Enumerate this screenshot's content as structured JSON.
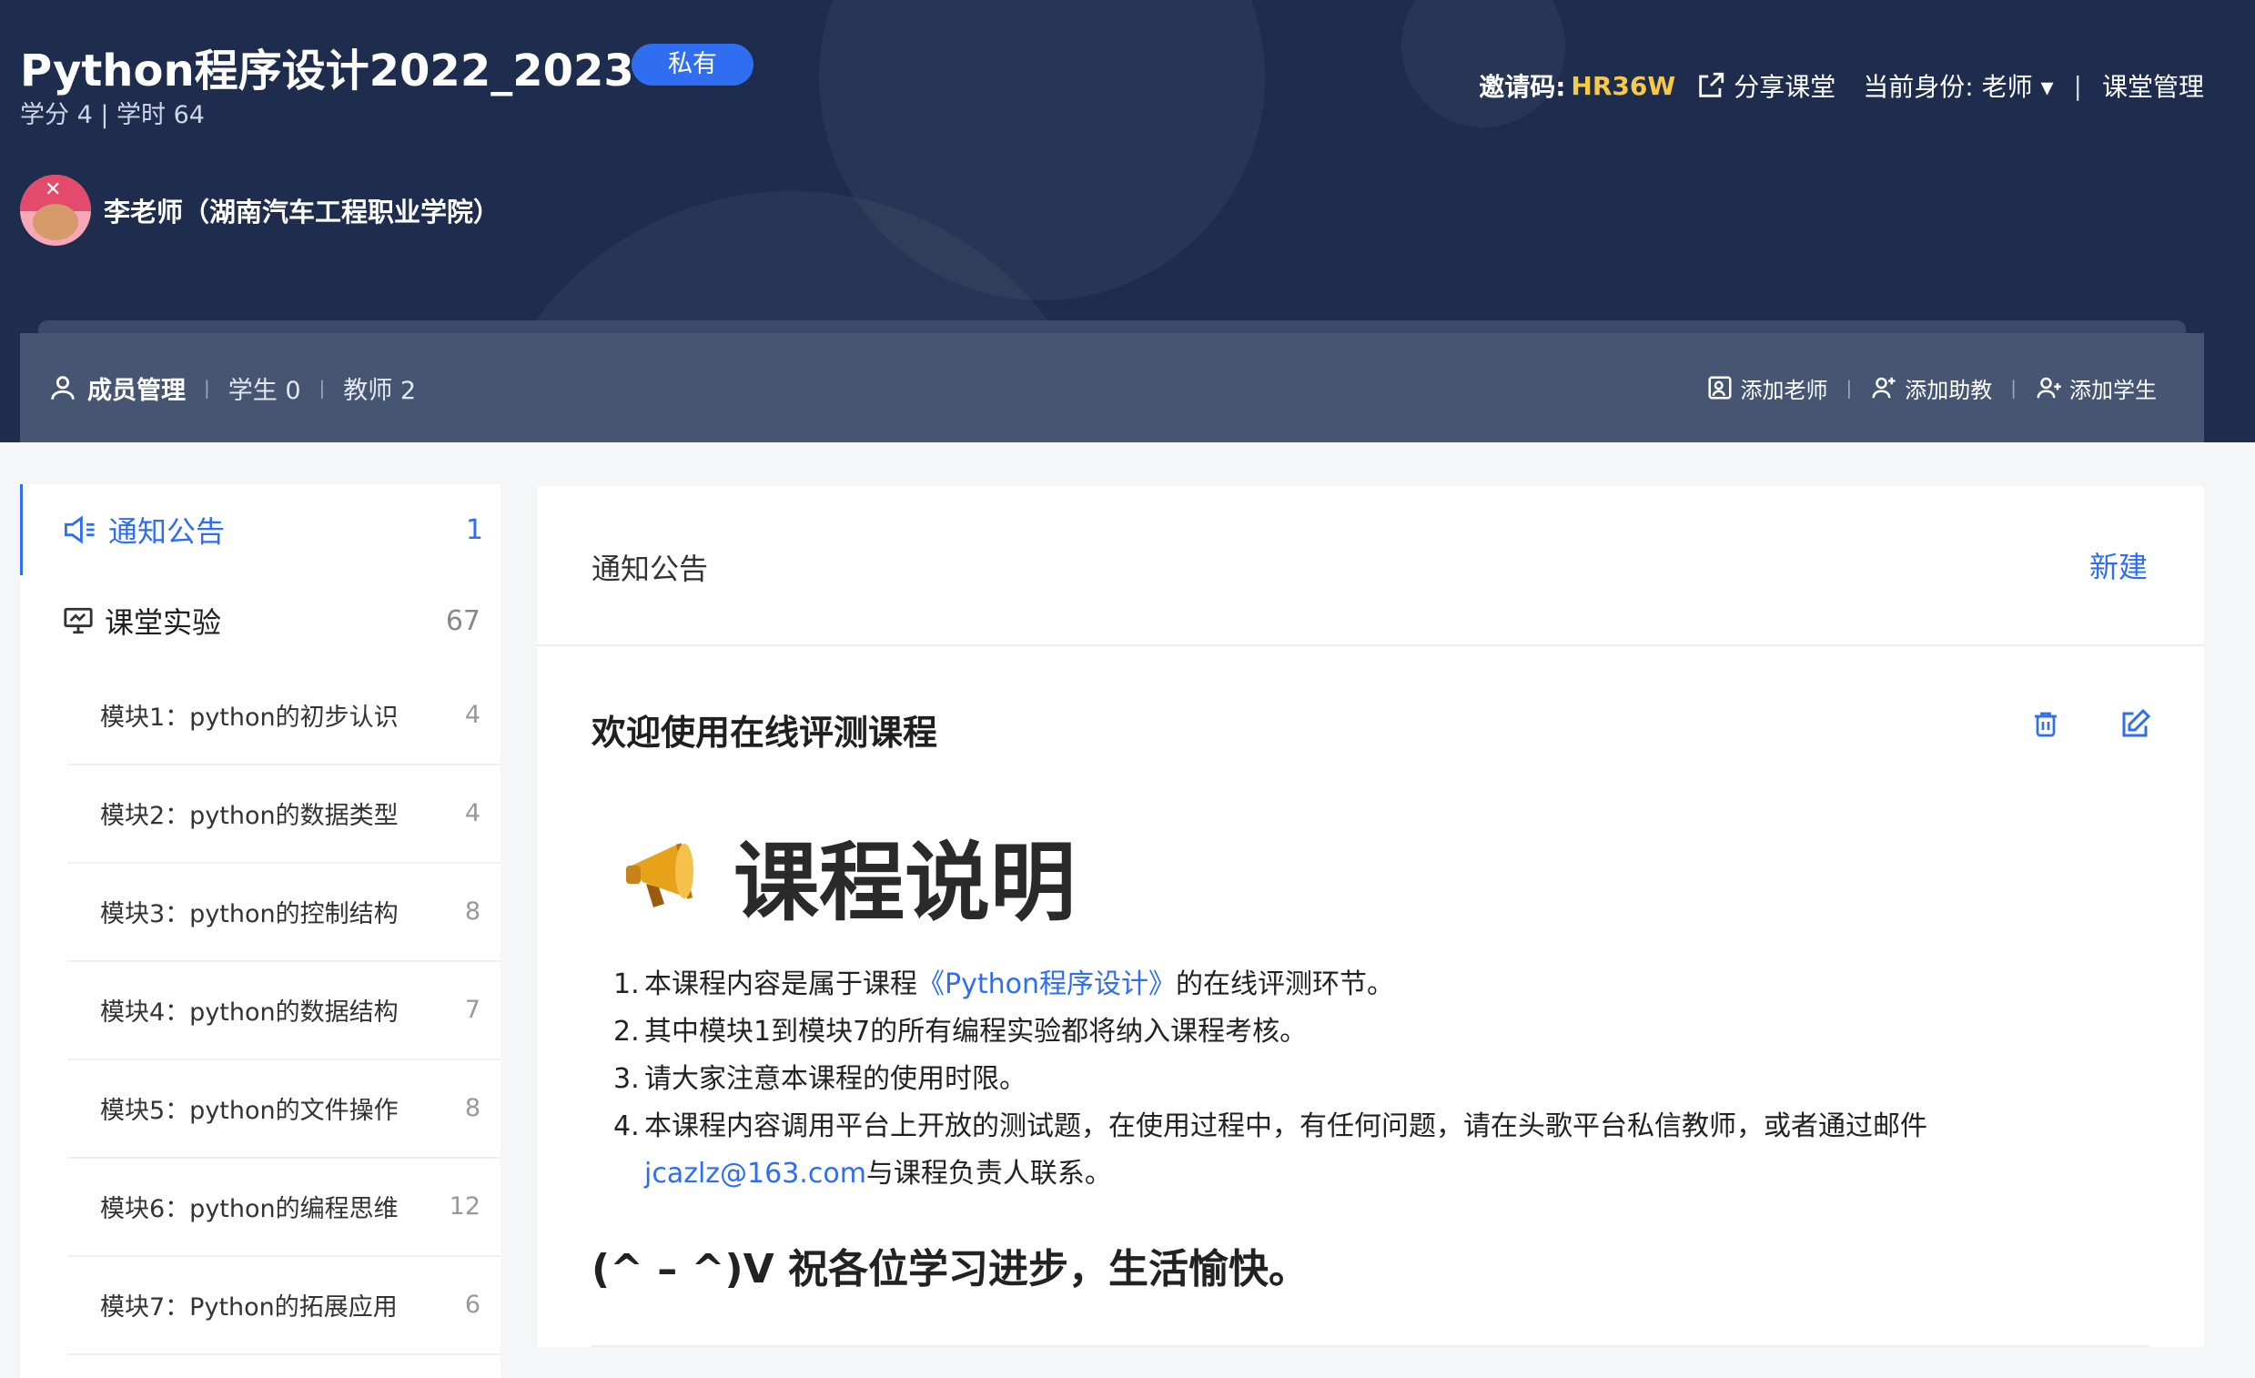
{
  "header": {
    "title": "Python程序设计2022_2023",
    "badge": "私有",
    "meta": "学分 4 | 学时 64",
    "teacher": "李老师（湖南汽车工程职业学院）",
    "invite_label": "邀请码:",
    "invite_code": "HR36W",
    "share_label": "分享课堂",
    "role_label": "当前身份: 老师 ▾",
    "separator": "|",
    "manage_label": "课堂管理"
  },
  "members_bar": {
    "title": "成员管理",
    "divider": "|",
    "students": "学生 0",
    "teachers": "教师 2",
    "add_teacher": "添加老师",
    "add_assistant": "添加助教",
    "add_student": "添加学生"
  },
  "sidebar": {
    "announcements": {
      "label": "通知公告",
      "count": "1"
    },
    "labs": {
      "label": "课堂实验",
      "count": "67"
    },
    "modules": [
      {
        "label": "模块1：python的初步认识",
        "count": "4"
      },
      {
        "label": "模块2：python的数据类型",
        "count": "4"
      },
      {
        "label": "模块3：python的控制结构",
        "count": "8"
      },
      {
        "label": "模块4：python的数据结构",
        "count": "7"
      },
      {
        "label": "模块5：python的文件操作",
        "count": "8"
      },
      {
        "label": "模块6：python的编程思维",
        "count": "12"
      },
      {
        "label": "模块7：Python的拓展应用",
        "count": "6"
      }
    ]
  },
  "main": {
    "panel_title": "通知公告",
    "new_label": "新建",
    "announcement": {
      "title": "欢迎使用在线评测课程",
      "heading": "课程说明",
      "items": [
        {
          "num": "1.",
          "before": "本课程内容是属于课程",
          "link": "《Python程序设计》",
          "after": "的在线评测环节。"
        },
        {
          "num": "2.",
          "text": "其中模块1到模块7的所有编程实验都将纳入课程考核。"
        },
        {
          "num": "3.",
          "text": "请大家注意本课程的使用时限。"
        },
        {
          "num": "4.",
          "before": "本课程内容调用平台上开放的测试题，在使用过程中，有任何问题，请在头歌平台私信教师，或者通过邮件",
          "link": "jcazlz@163.com",
          "after": "与课程负责人联系。"
        }
      ],
      "closing": "(^ – ^)V 祝各位学习进步，生活愉快。"
    }
  },
  "colors": {
    "header_bg": "#1e2d4d",
    "members_bar_bg": "#465672",
    "accent": "#2f6ef1",
    "invite_code": "#f7c948"
  }
}
